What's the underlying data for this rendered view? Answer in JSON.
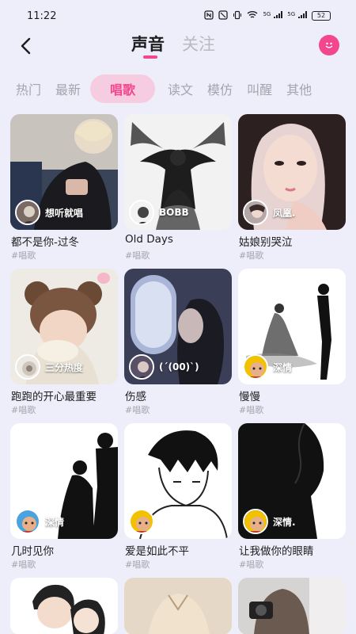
{
  "status_bar": {
    "time": "11:22",
    "signal_label": "5G",
    "battery": "52"
  },
  "header": {
    "tabs": [
      {
        "label": "声音",
        "active": true
      },
      {
        "label": "关注",
        "active": false
      }
    ],
    "accent_color": "#f2478e"
  },
  "sub_tabs": [
    {
      "label": "热门",
      "active": false
    },
    {
      "label": "最新",
      "active": false
    },
    {
      "label": "唱歌",
      "active": true
    },
    {
      "label": "读文",
      "active": false
    },
    {
      "label": "模仿",
      "active": false
    },
    {
      "label": "叫醒",
      "active": false
    },
    {
      "label": "其他",
      "active": false
    }
  ],
  "cards": [
    {
      "title": "都不是你-过冬",
      "tag": "#唱歌",
      "singer": "想听就唱",
      "image": "boy-hoodie-bed"
    },
    {
      "title": "Old Days",
      "tag": "#唱歌",
      "singer": "BOBB",
      "image": "dark-angel-art"
    },
    {
      "title": "姑娘别哭泣",
      "tag": "#唱歌",
      "singer": "凤凰.",
      "image": "girl-portrait-pink"
    },
    {
      "title": "跑跑的开心最重要",
      "tag": "#唱歌",
      "singer": "三分热度",
      "image": "girl-bear-hat"
    },
    {
      "title": "伤感",
      "tag": "#唱歌",
      "singer": "(´(00)`)",
      "image": "girl-plane-window"
    },
    {
      "title": "慢慢",
      "tag": "#唱歌",
      "singer": "深情",
      "image": "couple-ink-sketch"
    },
    {
      "title": "几时见你",
      "tag": "#唱歌",
      "singer": "深情",
      "image": "couple-silhouette"
    },
    {
      "title": "爱是如此不平",
      "tag": "#唱歌",
      "singer": "",
      "image": "boy-pixel-sketch"
    },
    {
      "title": "让我做你的眼睛",
      "tag": "#唱歌",
      "singer": "深情.",
      "image": "girl-silhouette"
    },
    {
      "title": "",
      "tag": "",
      "singer": "",
      "image": "cartoon-couple"
    },
    {
      "title": "",
      "tag": "",
      "singer": "",
      "image": "boy-shirt"
    },
    {
      "title": "",
      "tag": "",
      "singer": "",
      "image": "girl-camera"
    }
  ],
  "icons": {
    "back": "back-arrow-icon",
    "profile": "smiley-face-icon"
  }
}
